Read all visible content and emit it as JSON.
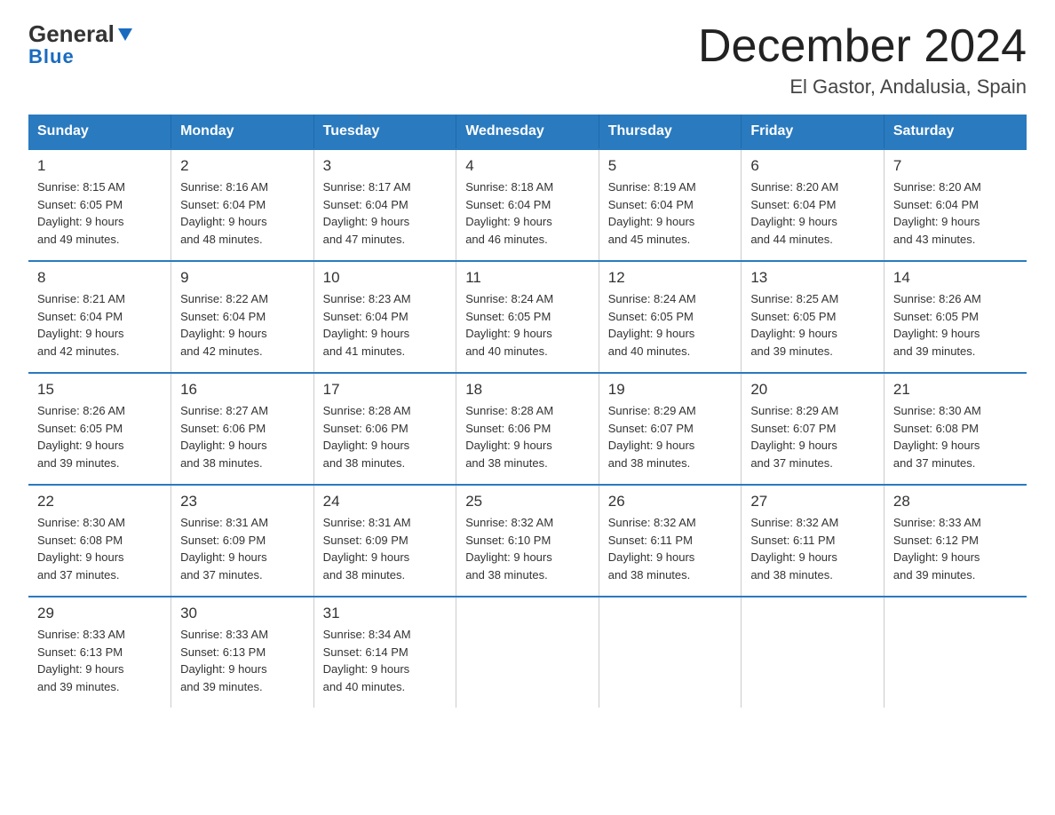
{
  "logo": {
    "general": "General",
    "blue": "Blue"
  },
  "title": "December 2024",
  "subtitle": "El Gastor, Andalusia, Spain",
  "days_of_week": [
    "Sunday",
    "Monday",
    "Tuesday",
    "Wednesday",
    "Thursday",
    "Friday",
    "Saturday"
  ],
  "weeks": [
    [
      {
        "day": "1",
        "info": "Sunrise: 8:15 AM\nSunset: 6:05 PM\nDaylight: 9 hours\nand 49 minutes."
      },
      {
        "day": "2",
        "info": "Sunrise: 8:16 AM\nSunset: 6:04 PM\nDaylight: 9 hours\nand 48 minutes."
      },
      {
        "day": "3",
        "info": "Sunrise: 8:17 AM\nSunset: 6:04 PM\nDaylight: 9 hours\nand 47 minutes."
      },
      {
        "day": "4",
        "info": "Sunrise: 8:18 AM\nSunset: 6:04 PM\nDaylight: 9 hours\nand 46 minutes."
      },
      {
        "day": "5",
        "info": "Sunrise: 8:19 AM\nSunset: 6:04 PM\nDaylight: 9 hours\nand 45 minutes."
      },
      {
        "day": "6",
        "info": "Sunrise: 8:20 AM\nSunset: 6:04 PM\nDaylight: 9 hours\nand 44 minutes."
      },
      {
        "day": "7",
        "info": "Sunrise: 8:20 AM\nSunset: 6:04 PM\nDaylight: 9 hours\nand 43 minutes."
      }
    ],
    [
      {
        "day": "8",
        "info": "Sunrise: 8:21 AM\nSunset: 6:04 PM\nDaylight: 9 hours\nand 42 minutes."
      },
      {
        "day": "9",
        "info": "Sunrise: 8:22 AM\nSunset: 6:04 PM\nDaylight: 9 hours\nand 42 minutes."
      },
      {
        "day": "10",
        "info": "Sunrise: 8:23 AM\nSunset: 6:04 PM\nDaylight: 9 hours\nand 41 minutes."
      },
      {
        "day": "11",
        "info": "Sunrise: 8:24 AM\nSunset: 6:05 PM\nDaylight: 9 hours\nand 40 minutes."
      },
      {
        "day": "12",
        "info": "Sunrise: 8:24 AM\nSunset: 6:05 PM\nDaylight: 9 hours\nand 40 minutes."
      },
      {
        "day": "13",
        "info": "Sunrise: 8:25 AM\nSunset: 6:05 PM\nDaylight: 9 hours\nand 39 minutes."
      },
      {
        "day": "14",
        "info": "Sunrise: 8:26 AM\nSunset: 6:05 PM\nDaylight: 9 hours\nand 39 minutes."
      }
    ],
    [
      {
        "day": "15",
        "info": "Sunrise: 8:26 AM\nSunset: 6:05 PM\nDaylight: 9 hours\nand 39 minutes."
      },
      {
        "day": "16",
        "info": "Sunrise: 8:27 AM\nSunset: 6:06 PM\nDaylight: 9 hours\nand 38 minutes."
      },
      {
        "day": "17",
        "info": "Sunrise: 8:28 AM\nSunset: 6:06 PM\nDaylight: 9 hours\nand 38 minutes."
      },
      {
        "day": "18",
        "info": "Sunrise: 8:28 AM\nSunset: 6:06 PM\nDaylight: 9 hours\nand 38 minutes."
      },
      {
        "day": "19",
        "info": "Sunrise: 8:29 AM\nSunset: 6:07 PM\nDaylight: 9 hours\nand 38 minutes."
      },
      {
        "day": "20",
        "info": "Sunrise: 8:29 AM\nSunset: 6:07 PM\nDaylight: 9 hours\nand 37 minutes."
      },
      {
        "day": "21",
        "info": "Sunrise: 8:30 AM\nSunset: 6:08 PM\nDaylight: 9 hours\nand 37 minutes."
      }
    ],
    [
      {
        "day": "22",
        "info": "Sunrise: 8:30 AM\nSunset: 6:08 PM\nDaylight: 9 hours\nand 37 minutes."
      },
      {
        "day": "23",
        "info": "Sunrise: 8:31 AM\nSunset: 6:09 PM\nDaylight: 9 hours\nand 37 minutes."
      },
      {
        "day": "24",
        "info": "Sunrise: 8:31 AM\nSunset: 6:09 PM\nDaylight: 9 hours\nand 38 minutes."
      },
      {
        "day": "25",
        "info": "Sunrise: 8:32 AM\nSunset: 6:10 PM\nDaylight: 9 hours\nand 38 minutes."
      },
      {
        "day": "26",
        "info": "Sunrise: 8:32 AM\nSunset: 6:11 PM\nDaylight: 9 hours\nand 38 minutes."
      },
      {
        "day": "27",
        "info": "Sunrise: 8:32 AM\nSunset: 6:11 PM\nDaylight: 9 hours\nand 38 minutes."
      },
      {
        "day": "28",
        "info": "Sunrise: 8:33 AM\nSunset: 6:12 PM\nDaylight: 9 hours\nand 39 minutes."
      }
    ],
    [
      {
        "day": "29",
        "info": "Sunrise: 8:33 AM\nSunset: 6:13 PM\nDaylight: 9 hours\nand 39 minutes."
      },
      {
        "day": "30",
        "info": "Sunrise: 8:33 AM\nSunset: 6:13 PM\nDaylight: 9 hours\nand 39 minutes."
      },
      {
        "day": "31",
        "info": "Sunrise: 8:34 AM\nSunset: 6:14 PM\nDaylight: 9 hours\nand 40 minutes."
      },
      {
        "day": "",
        "info": ""
      },
      {
        "day": "",
        "info": ""
      },
      {
        "day": "",
        "info": ""
      },
      {
        "day": "",
        "info": ""
      }
    ]
  ]
}
